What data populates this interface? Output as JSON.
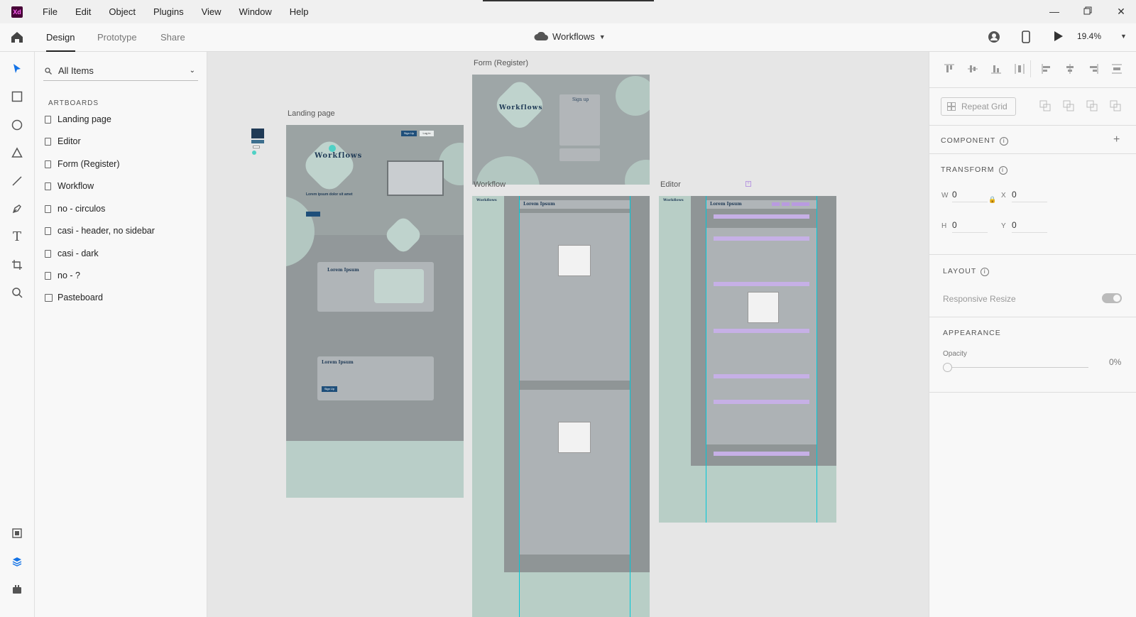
{
  "app": {
    "logo": "Xd"
  },
  "menu": [
    "File",
    "Edit",
    "Object",
    "Plugins",
    "View",
    "Window",
    "Help"
  ],
  "toolbar": {
    "tabs": [
      "Design",
      "Prototype",
      "Share"
    ],
    "active_tab": "Design",
    "doc_title": "Workflows",
    "zoom": "19.4%"
  },
  "layers": {
    "filter_label": "All Items",
    "heading": "ARTBOARDS",
    "items": [
      "Landing page",
      "Editor",
      "Form (Register)",
      "Workflow",
      "no - circulos",
      "casi - header, no sidebar",
      "casi - dark",
      "no - ?"
    ],
    "pasteboard": "Pasteboard"
  },
  "canvas": {
    "labels": {
      "landing": "Landing page",
      "form": "Form (Register)",
      "workflow": "Workflow",
      "editor": "Editor"
    },
    "landing": {
      "brand": "Workflows",
      "signup": "Sign Up",
      "login": "Log in",
      "headline": "Lorem ipsum dolor sit amet",
      "card1_title": "Lorem Ipsum",
      "card2_title": "Lorem Ipsum",
      "card2_cta": "Sign Up"
    },
    "form": {
      "brand": "Workflows",
      "title": "Sign up"
    },
    "workflow": {
      "brand": "Workflows",
      "title": "Lorem Ipsum"
    },
    "editor": {
      "brand": "Workflows",
      "title": "Lorem Ipsum"
    }
  },
  "inspector": {
    "repeat_grid": "Repeat Grid",
    "component": "COMPONENT",
    "transform": "TRANSFORM",
    "w_label": "W",
    "w": "0",
    "x_label": "X",
    "x": "0",
    "h_label": "H",
    "h": "0",
    "y_label": "Y",
    "y": "0",
    "layout": "LAYOUT",
    "responsive_resize": "Responsive Resize",
    "appearance": "APPEARANCE",
    "opacity_label": "Opacity",
    "opacity": "0%"
  },
  "colors": {
    "accent": "#2c2c2c",
    "artboard_bg": "#8f9596",
    "mint": "#b8cec6",
    "guide": "#00c8d8",
    "purple": "#b99ae0"
  }
}
